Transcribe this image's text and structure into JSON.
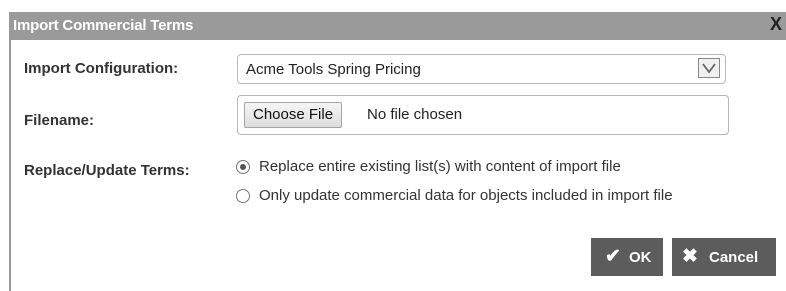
{
  "dialog": {
    "title": "Import Commercial Terms",
    "close_glyph": "X"
  },
  "form": {
    "import_config_label": "Import Configuration:",
    "import_config_value": "Acme Tools Spring Pricing",
    "filename_label": "Filename:",
    "choose_file_label": "Choose File",
    "file_status": "No file chosen",
    "replace_update_label": "Replace/Update Terms:",
    "options": [
      {
        "label": "Replace entire existing list(s) with content of import file",
        "selected": true
      },
      {
        "label": "Only update commercial data for objects included in import file",
        "selected": false
      }
    ]
  },
  "buttons": {
    "ok_label": "OK",
    "cancel_label": "Cancel"
  },
  "icons": {
    "ok": "check-icon",
    "cancel": "x-icon",
    "select_arrow": "chevron-down-icon",
    "close": "close-icon"
  },
  "colors": {
    "titlebar": "#9a9a9a",
    "button": "#5c5c5c",
    "button_text": "#ffffff"
  }
}
